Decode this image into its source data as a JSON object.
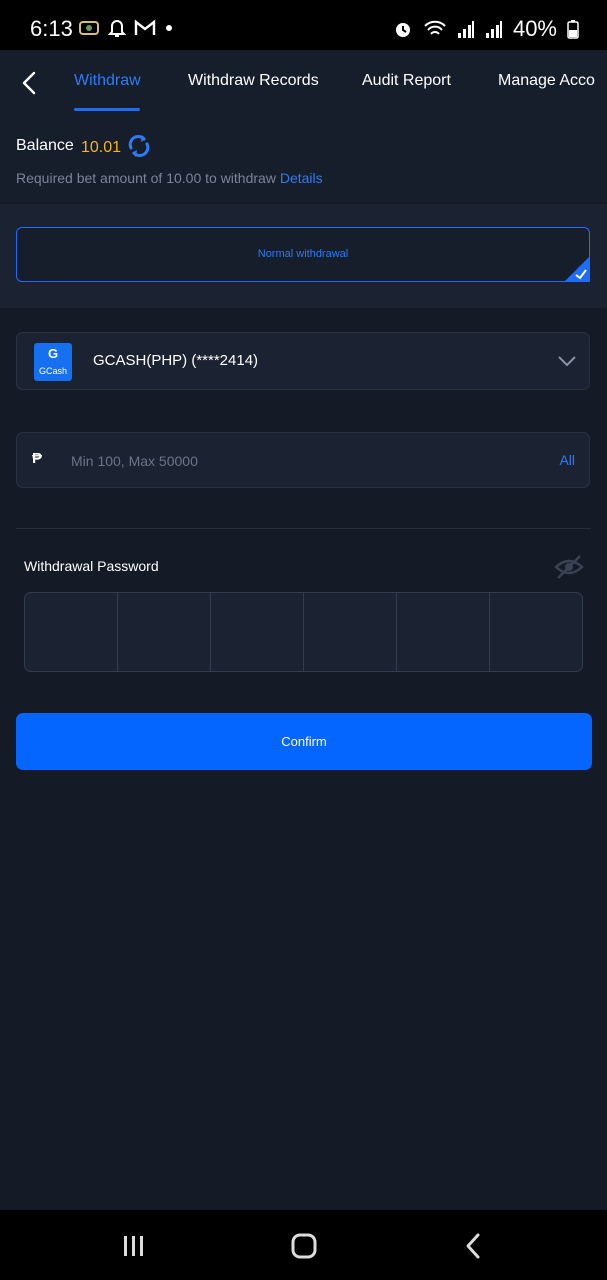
{
  "status_bar": {
    "time": "6:13",
    "battery_text": "40%"
  },
  "header": {
    "tabs": [
      {
        "label": "Withdraw",
        "active": true
      },
      {
        "label": "Withdraw Records",
        "active": false
      },
      {
        "label": "Audit Report",
        "active": false
      },
      {
        "label": "Manage Acco",
        "active": false
      }
    ]
  },
  "balance": {
    "label": "Balance",
    "value": "10.01",
    "requirement_text": "Required bet amount of 10.00 to withdraw",
    "details_link": "Details"
  },
  "withdraw_type": {
    "label": "Normal withdrawal",
    "selected": true
  },
  "method": {
    "logo_letter": "G",
    "logo_text": "GCash",
    "label": "GCASH(PHP) (****2414)"
  },
  "amount": {
    "currency_symbol": "₱",
    "value": "",
    "placeholder": "Min 100, Max 50000",
    "all_label": "All"
  },
  "password": {
    "label": "Withdrawal Password",
    "digits": 6
  },
  "confirm": {
    "label": "Confirm"
  },
  "colors": {
    "accent": "#1e6df6",
    "balance": "#f4b426",
    "background": "#141a26",
    "button": "#0565ff"
  }
}
